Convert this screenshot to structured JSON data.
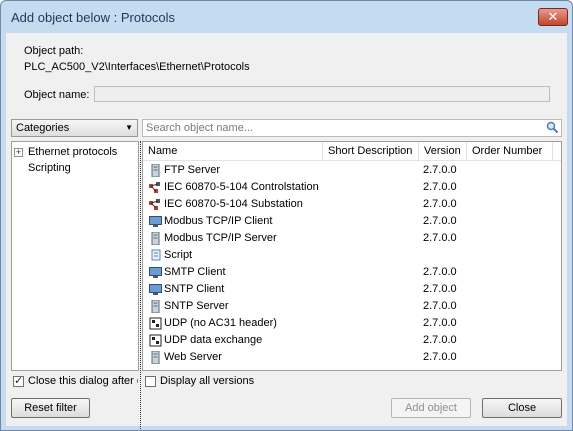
{
  "window": {
    "title": "Add object below : Protocols",
    "close_glyph": "✕"
  },
  "object_path": {
    "label": "Object path:",
    "value": "PLC_AC500_V2\\Interfaces\\Ethernet\\Protocols"
  },
  "object_name": {
    "label": "Object name:",
    "value": ""
  },
  "categories_dropdown": {
    "selected": "Categories"
  },
  "search": {
    "placeholder": "Search object name...",
    "icon": "magnifier-icon"
  },
  "tree": {
    "nodes": [
      {
        "label": "Ethernet protocols",
        "expandable": true,
        "expander": "+"
      },
      {
        "label": "Scripting",
        "expandable": false
      }
    ]
  },
  "grid": {
    "columns": [
      "Name",
      "Short Description",
      "Version",
      "Order Number"
    ],
    "rows": [
      {
        "name": "FTP Server",
        "version": "2.7.0.0",
        "icon": "server-icon"
      },
      {
        "name": "IEC 60870-5-104 Controlstation",
        "version": "2.7.0.0",
        "icon": "iec-network-icon"
      },
      {
        "name": "IEC 60870-5-104 Substation",
        "version": "2.7.0.0",
        "icon": "iec-network-icon"
      },
      {
        "name": "Modbus TCP/IP Client",
        "version": "2.7.0.0",
        "icon": "monitor-icon"
      },
      {
        "name": "Modbus TCP/IP Server",
        "version": "2.7.0.0",
        "icon": "server-icon"
      },
      {
        "name": "Script",
        "version": "",
        "icon": "script-icon"
      },
      {
        "name": "SMTP Client",
        "version": "2.7.0.0",
        "icon": "monitor-icon"
      },
      {
        "name": "SNTP Client",
        "version": "2.7.0.0",
        "icon": "monitor-icon"
      },
      {
        "name": "SNTP Server",
        "version": "2.7.0.0",
        "icon": "server-icon"
      },
      {
        "name": "UDP (no AC31 header)",
        "version": "2.7.0.0",
        "icon": "udp-icon"
      },
      {
        "name": "UDP data exchange",
        "version": "2.7.0.0",
        "icon": "udp-icon"
      },
      {
        "name": "Web Server",
        "version": "2.7.0.0",
        "icon": "server-icon"
      }
    ]
  },
  "options": {
    "close_after_insert": {
      "label": "Close this dialog after ea",
      "checked": true
    },
    "display_all_versions": {
      "label": "Display all versions",
      "checked": false
    }
  },
  "buttons": {
    "reset_filter": "Reset filter",
    "add_object": "Add object",
    "close": "Close"
  }
}
